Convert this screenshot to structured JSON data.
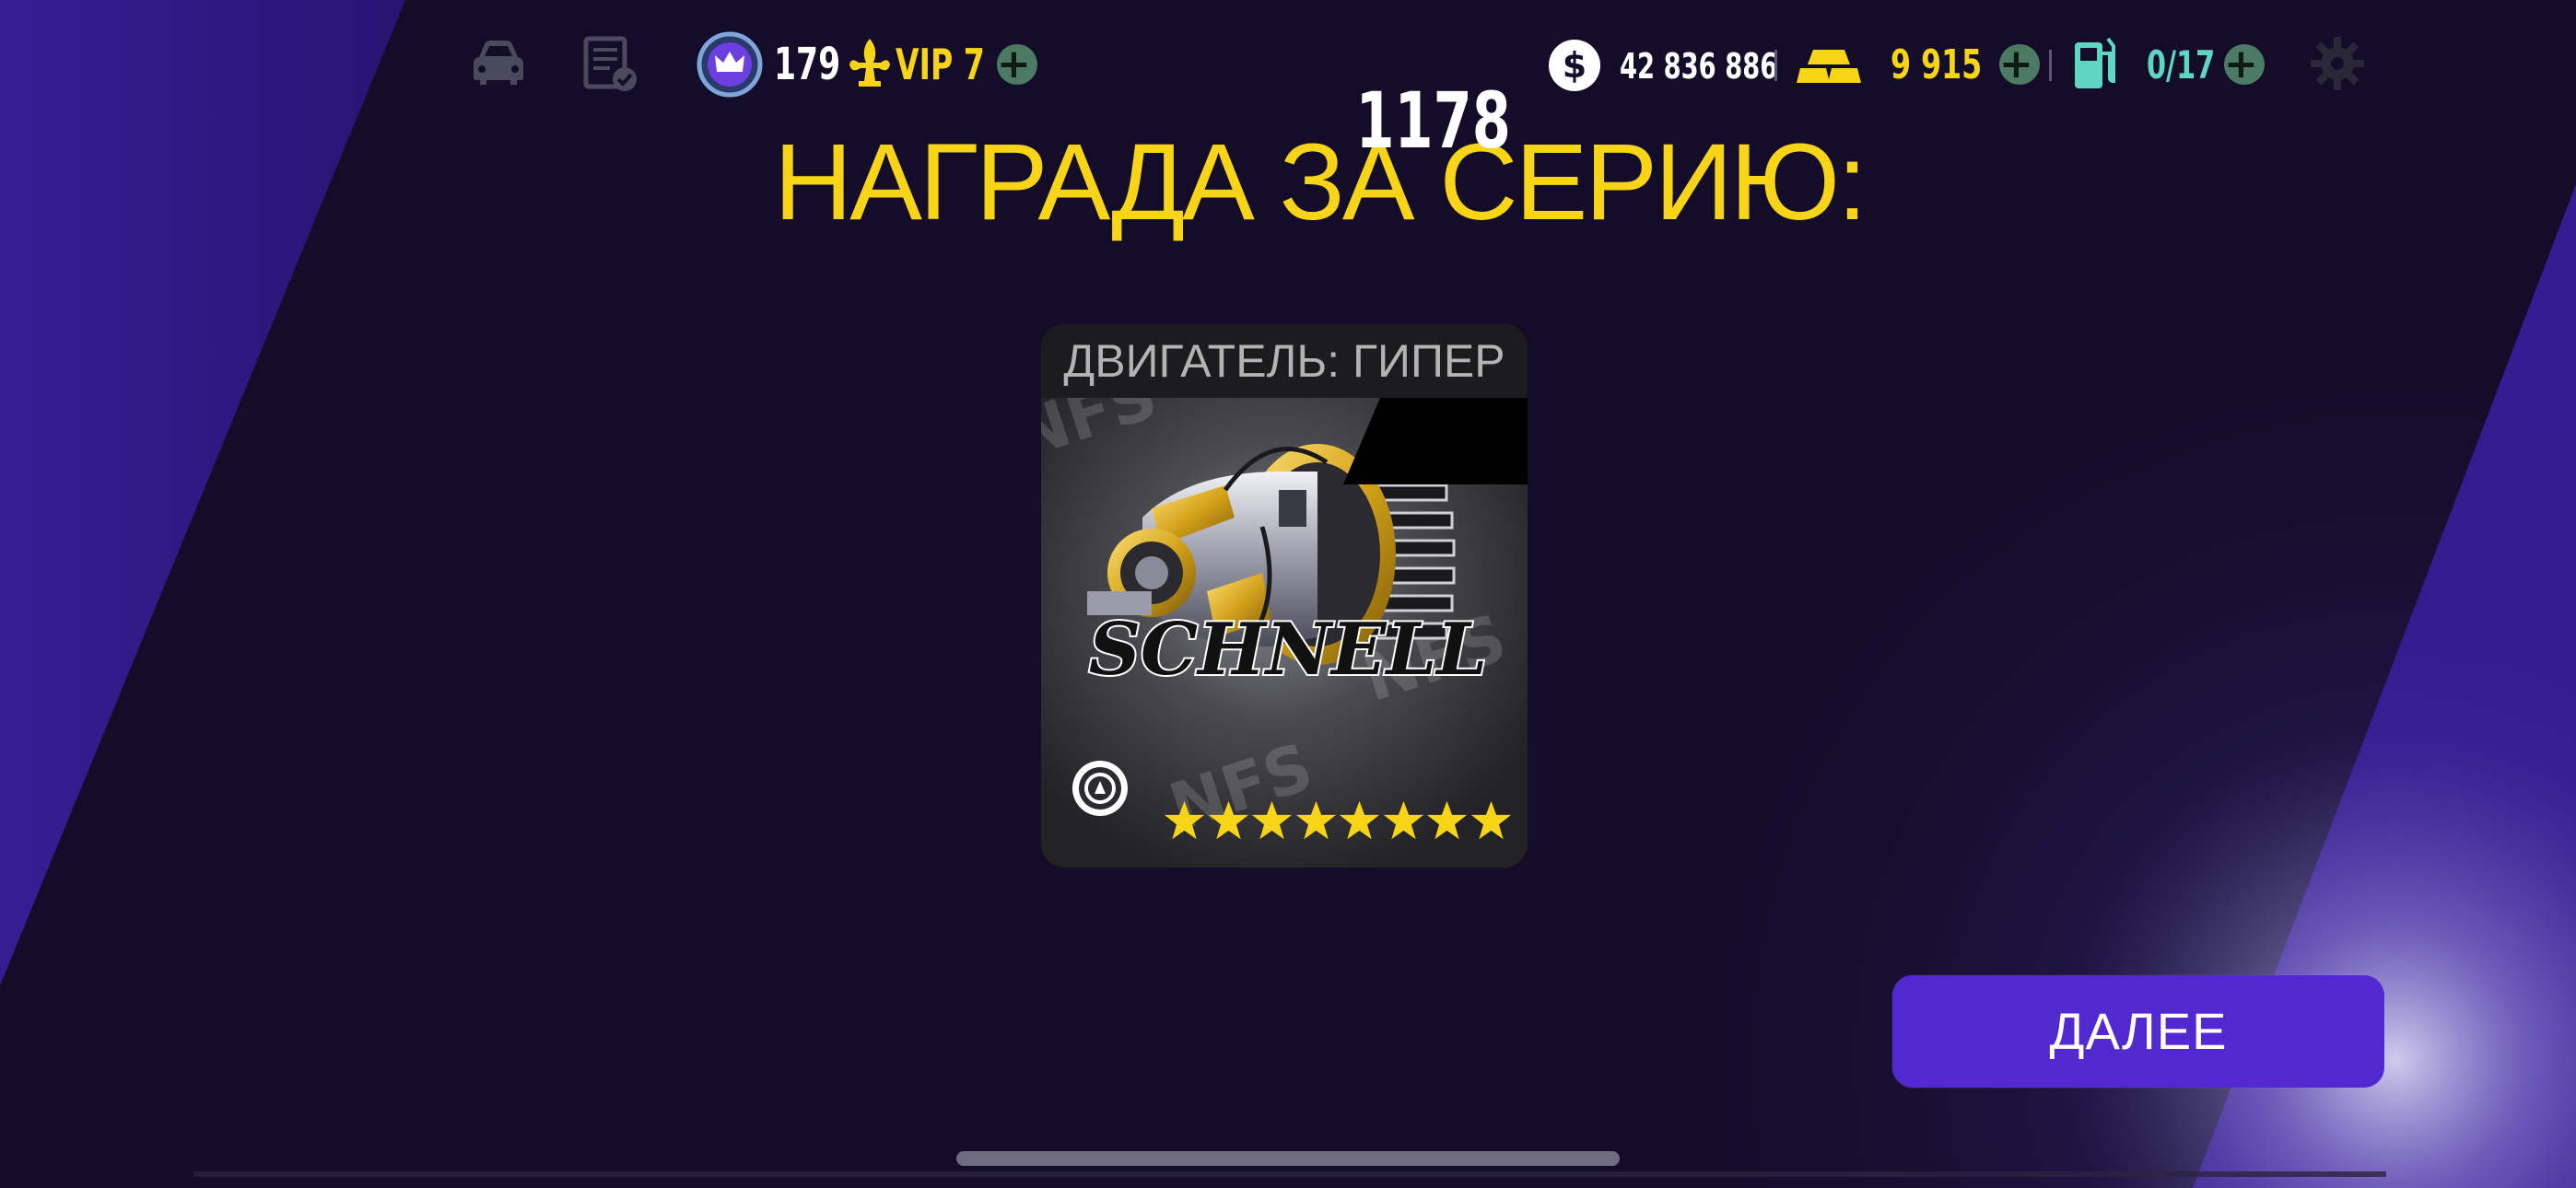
{
  "topbar": {
    "garage_icon": "car-icon",
    "tasks_icon": "checklist-icon",
    "level": "179",
    "vip_label": "VIP 7",
    "cash": "42 836 886",
    "gold": "9 915",
    "fuel": "0/17",
    "colors": {
      "gold_text": "#f7d417",
      "fuel_text": "#5fd6c4",
      "plus_bg": "#4d7a63"
    }
  },
  "title": "НАГРАДА ЗА СЕРИЮ:",
  "reward": {
    "header": "ДВИГАТЕЛЬ: ГИПЕР",
    "value": "1178",
    "brand": "SCHNELL",
    "watermark_text": "NFS NO LIMITS",
    "stars": 8,
    "part_icon": "turbo-fan-icon"
  },
  "next_button": "ДАЛЕЕ",
  "colors": {
    "accent": "#5228d0",
    "title": "#f7d417",
    "background": "#140d2a"
  }
}
